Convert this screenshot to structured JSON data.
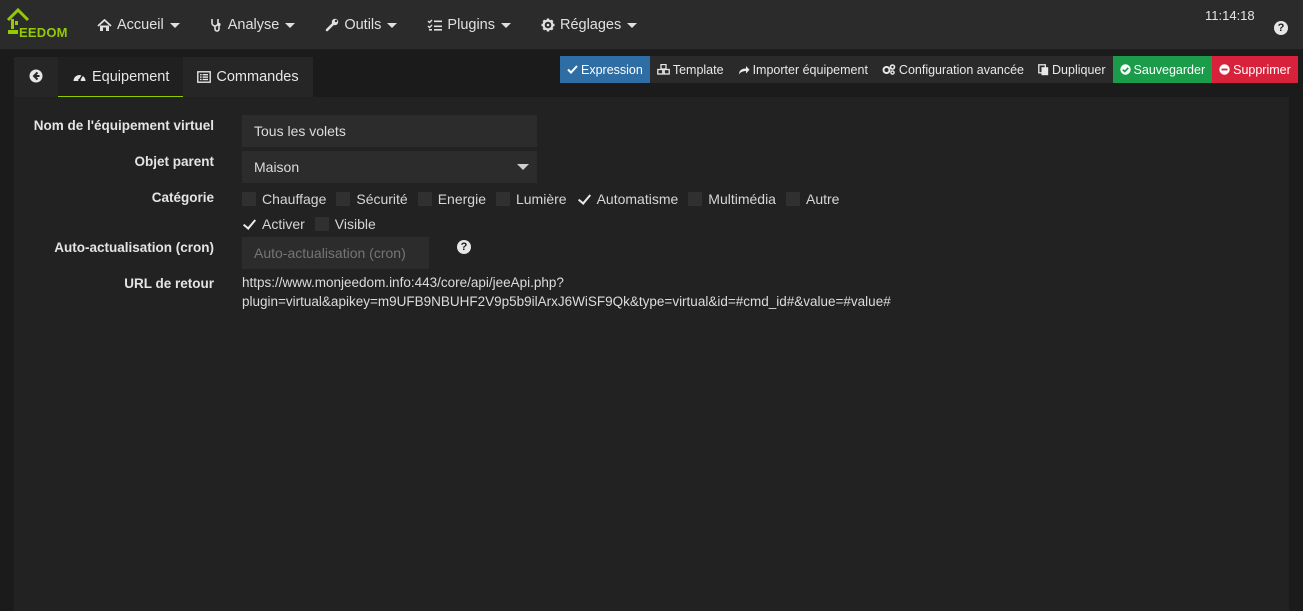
{
  "nav": {
    "logo_text": "EEDOM",
    "items": [
      {
        "label": "Accueil",
        "icon": "home-icon"
      },
      {
        "label": "Analyse",
        "icon": "stethoscope-icon"
      },
      {
        "label": "Outils",
        "icon": "wrench-icon"
      },
      {
        "label": "Plugins",
        "icon": "tasks-icon"
      },
      {
        "label": "Réglages",
        "icon": "gear-icon"
      }
    ],
    "clock": "11:14:18",
    "help": "?"
  },
  "tabs": {
    "items": [
      {
        "label": "Equipement",
        "icon": "tachometer-icon",
        "active": true
      },
      {
        "label": "Commandes",
        "icon": "list-alt-icon",
        "active": false
      }
    ]
  },
  "toolbar": {
    "buttons": [
      {
        "label": "Expression",
        "icon": "check-icon",
        "color": "#2f6ea5"
      },
      {
        "label": "Template",
        "icon": "cubes-icon"
      },
      {
        "label": "Importer équipement",
        "icon": "share-icon"
      },
      {
        "label": "Configuration avancée",
        "icon": "cogs-icon"
      },
      {
        "label": "Dupliquer",
        "icon": "copy-icon"
      },
      {
        "label": "Sauvegarder",
        "icon": "check-circle-icon",
        "color": "#1b9c4a"
      },
      {
        "label": "Supprimer",
        "icon": "minus-circle-icon",
        "color": "#d8223c"
      }
    ]
  },
  "form": {
    "name": {
      "label": "Nom de l'équipement virtuel",
      "value": "Tous les volets"
    },
    "parent": {
      "label": "Objet parent",
      "value": "Maison"
    },
    "category": {
      "label": "Catégorie",
      "options": [
        {
          "label": "Chauffage",
          "checked": false
        },
        {
          "label": "Sécurité",
          "checked": false
        },
        {
          "label": "Energie",
          "checked": false
        },
        {
          "label": "Lumière",
          "checked": false
        },
        {
          "label": "Automatisme",
          "checked": true
        },
        {
          "label": "Multimédia",
          "checked": false
        },
        {
          "label": "Autre",
          "checked": false
        }
      ]
    },
    "flags": [
      {
        "label": "Activer",
        "checked": true
      },
      {
        "label": "Visible",
        "checked": false
      }
    ],
    "cron": {
      "label": "Auto-actualisation (cron)",
      "placeholder": "Auto-actualisation (cron)",
      "help": "?"
    },
    "url": {
      "label": "URL de retour",
      "line1": "https://www.monjeedom.info:443/core/api/jeeApi.php?",
      "line2": "plugin=virtual&apikey=m9UFB9NBUHF2V9p5b9ilArxJ6WiSF9Qk&type=virtual&id=#cmd_id#&value=#value#"
    }
  }
}
